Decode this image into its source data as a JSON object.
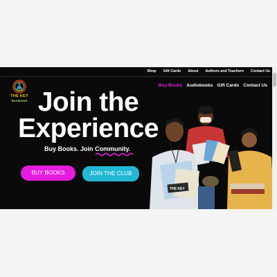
{
  "topnav": [
    "Shop",
    "Gift Cards",
    "About",
    "Authors and Teachers",
    "Contact Us"
  ],
  "logo": {
    "line1": "THE KEY",
    "line2": "Bookstore"
  },
  "mainnav": [
    {
      "label": "Buy Books",
      "active": true
    },
    {
      "label": "Audiobooks",
      "active": false
    },
    {
      "label": "Gift Cards",
      "active": false
    },
    {
      "label": "Contact Us",
      "active": false
    }
  ],
  "hero": {
    "line1": "Join the",
    "line2": "Experience",
    "tagline": "Buy Books. Join Community."
  },
  "buttons": {
    "buy": "BUY BOOKS",
    "club": "JOIN THE CLUB"
  },
  "photo_text": {
    "book_sign": "THE KEY"
  },
  "colors": {
    "accent": "#e61be0",
    "secondary": "#22b8d3",
    "background": "#0a0a0a"
  }
}
